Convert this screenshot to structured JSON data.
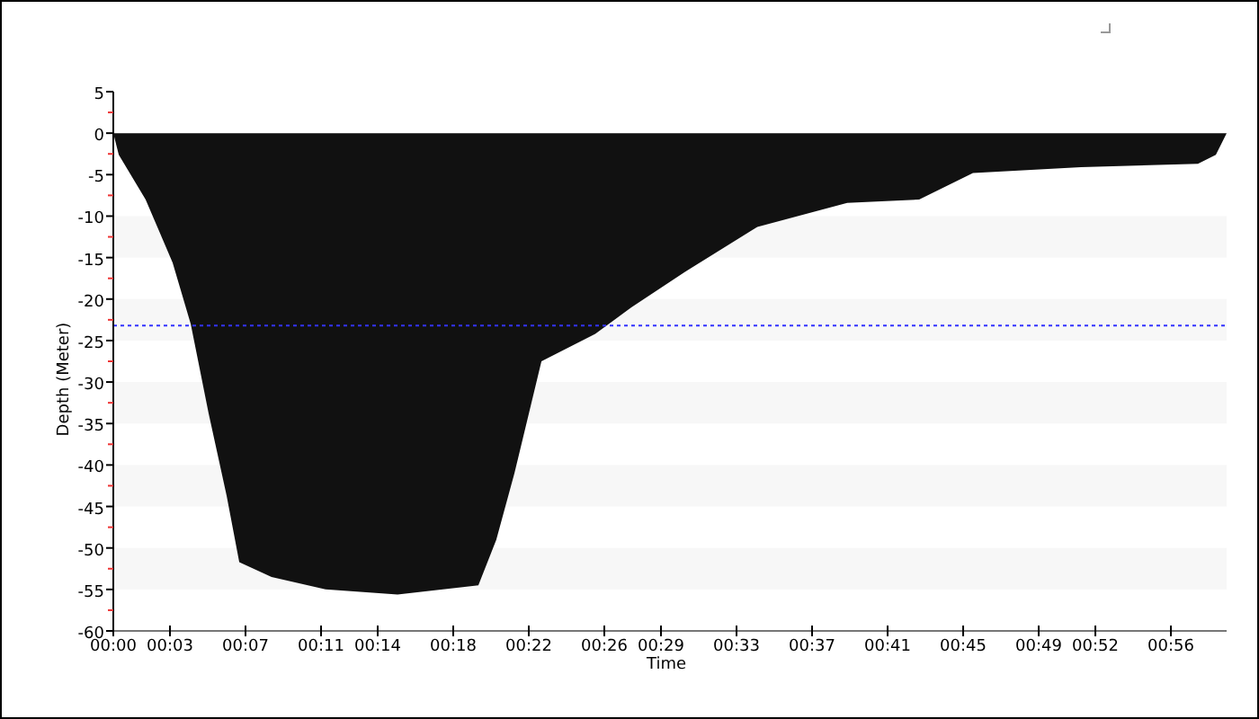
{
  "chart": {
    "chart_data": {
      "type": "area",
      "xlabel": "Time",
      "ylabel": "Depth (Meter)",
      "x": [
        0,
        0.29,
        1.71,
        3.14,
        4.1,
        5.05,
        6.0,
        6.67,
        8.38,
        11.24,
        15.05,
        19.33,
        20.28,
        21.24,
        22.67,
        25.52,
        27.43,
        30.29,
        34.1,
        38.86,
        42.67,
        45.52,
        51.24,
        57.43,
        58.38,
        58.95
      ],
      "series": [
        {
          "color": "#111111",
          "values": [
            0,
            -2.6,
            -8.0,
            -15.6,
            -23.0,
            -33.8,
            -43.7,
            -51.7,
            -53.5,
            -55.0,
            -55.6,
            -54.5,
            -49.0,
            -41.0,
            -27.5,
            -24.2,
            -21.0,
            -16.7,
            -11.3,
            -8.4,
            -8.0,
            -4.8,
            -4.1,
            -3.7,
            -2.6,
            0
          ]
        }
      ],
      "xlim": [
        0,
        58.95
      ],
      "ylim": [
        -60,
        5
      ],
      "xticks": [
        {
          "value": 0,
          "label": "00:00"
        },
        {
          "value": 3,
          "label": "00:03"
        },
        {
          "value": 7,
          "label": "00:07"
        },
        {
          "value": 11,
          "label": "00:11"
        },
        {
          "value": 14,
          "label": "00:14"
        },
        {
          "value": 18,
          "label": "00:18"
        },
        {
          "value": 22,
          "label": "00:22"
        },
        {
          "value": 26,
          "label": "00:26"
        },
        {
          "value": 29,
          "label": "00:29"
        },
        {
          "value": 33,
          "label": "00:33"
        },
        {
          "value": 37,
          "label": "00:37"
        },
        {
          "value": 41,
          "label": "00:41"
        },
        {
          "value": 45,
          "label": "00:45"
        },
        {
          "value": 49,
          "label": "00:49"
        },
        {
          "value": 52,
          "label": "00:52"
        },
        {
          "value": 56,
          "label": "00:56"
        }
      ],
      "yticks": [
        5,
        0,
        -5,
        -10,
        -15,
        -20,
        -25,
        -30,
        -35,
        -40,
        -45,
        -50,
        -55,
        -60
      ],
      "ref_lines": [
        {
          "axis": "y",
          "value": -23.2,
          "color": "#3333ff"
        }
      ]
    }
  }
}
